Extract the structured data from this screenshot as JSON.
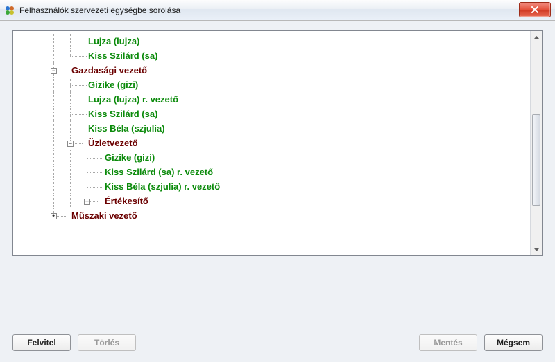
{
  "window": {
    "title": "Felhasználók szervezeti egységbe sorolása"
  },
  "tree": {
    "rows": [
      {
        "indent": 3,
        "kind": "leaf",
        "expander": null,
        "label": "Lujza (lujza)"
      },
      {
        "indent": 3,
        "kind": "leaf",
        "expander": null,
        "label": "Kiss Szilárd (sa)"
      },
      {
        "indent": 2,
        "kind": "group",
        "expander": "collapse",
        "label": "Gazdasági vezető"
      },
      {
        "indent": 3,
        "kind": "leaf",
        "expander": null,
        "label": "Gizike (gizi)"
      },
      {
        "indent": 3,
        "kind": "leaf",
        "expander": null,
        "label": "Lujza (lujza) r. vezető"
      },
      {
        "indent": 3,
        "kind": "leaf",
        "expander": null,
        "label": "Kiss Szilárd (sa)"
      },
      {
        "indent": 3,
        "kind": "leaf",
        "expander": null,
        "label": "Kiss Béla (szjulia)"
      },
      {
        "indent": 3,
        "kind": "group",
        "expander": "collapse",
        "label": "Üzletvezető"
      },
      {
        "indent": 4,
        "kind": "leaf",
        "expander": null,
        "label": "Gizike (gizi)"
      },
      {
        "indent": 4,
        "kind": "leaf",
        "expander": null,
        "label": "Kiss Szilárd (sa) r. vezető"
      },
      {
        "indent": 4,
        "kind": "leaf",
        "expander": null,
        "label": "Kiss Béla (szjulia) r. vezető"
      },
      {
        "indent": 4,
        "kind": "group",
        "expander": "expand",
        "label": "Értékesítő"
      },
      {
        "indent": 2,
        "kind": "group",
        "expander": "expand",
        "label": "Műszaki vezető",
        "cut": true
      }
    ]
  },
  "buttons": {
    "felvitel": "Felvitel",
    "torles": "Törlés",
    "mentes": "Mentés",
    "megsem": "Mégsem"
  }
}
